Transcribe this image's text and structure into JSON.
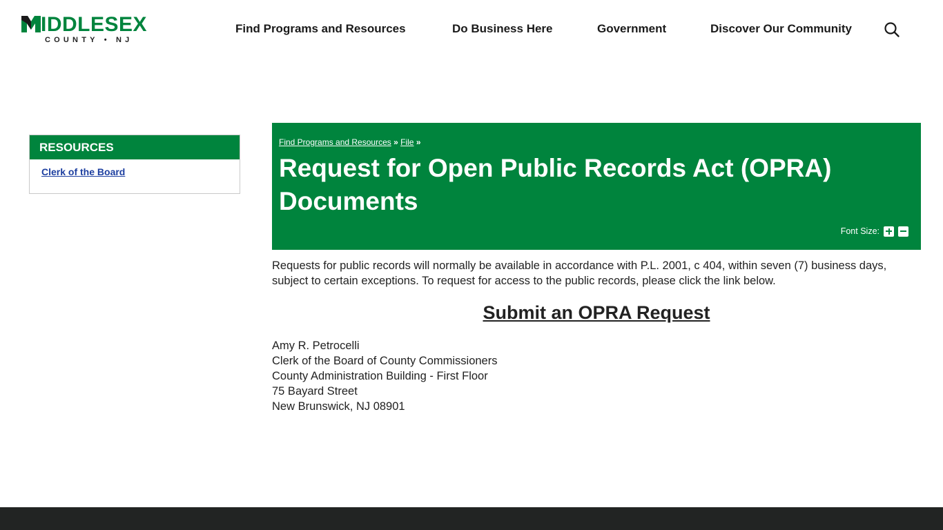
{
  "header": {
    "logo": {
      "word": "MIDDLESEX",
      "word_tail": "IDDLESEX",
      "sub": "COUNTY • NJ"
    },
    "nav": [
      {
        "label": "Find Programs and Resources"
      },
      {
        "label": "Do Business Here"
      },
      {
        "label": "Government"
      },
      {
        "label": "Discover Our Community"
      }
    ],
    "search_icon": "search-icon"
  },
  "sidebar": {
    "title": "RESOURCES",
    "links": [
      {
        "label": "Clerk of the Board"
      }
    ]
  },
  "banner": {
    "breadcrumbs": [
      {
        "label": "Find Programs and Resources"
      },
      {
        "label": "File"
      }
    ],
    "separator": "»",
    "title": "Request for Open Public Records Act (OPRA) Documents",
    "font_size_label": "Font Size:"
  },
  "content": {
    "intro": "Requests for public records will normally be available in accordance with P.L. 2001, c 404, within seven (7) business days, subject to certain exceptions. To request for access to the public records, please click the link below.",
    "cta": "Submit an OPRA Request",
    "address": [
      "Amy R. Petrocelli",
      "Clerk of the Board of County Commissioners",
      "County Administration Building - First Floor",
      "75 Bayard Street",
      "New Brunswick, NJ 08901"
    ]
  },
  "colors": {
    "brand_green": "#00843d",
    "link_blue": "#1d3fa0",
    "footer_dark": "#222423"
  }
}
